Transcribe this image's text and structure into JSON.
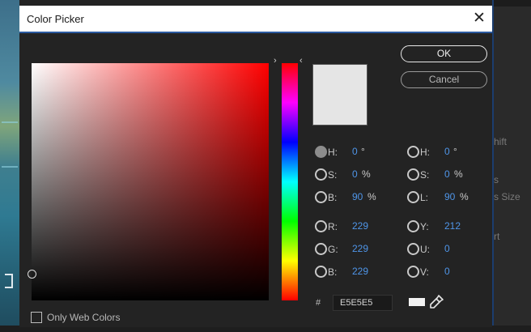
{
  "dialog": {
    "title": "Color Picker",
    "close_glyph": "✕",
    "ok_label": "OK",
    "cancel_label": "Cancel"
  },
  "current_color": "#E5E5E5",
  "hex": {
    "hash": "#",
    "value": "E5E5E5"
  },
  "hsb": {
    "h": {
      "label": "H:",
      "value": "0",
      "unit": "°",
      "selected": true
    },
    "s": {
      "label": "S:",
      "value": "0",
      "unit": "%"
    },
    "b": {
      "label": "B:",
      "value": "90",
      "unit": "%"
    }
  },
  "hsl": {
    "h": {
      "label": "H:",
      "value": "0",
      "unit": "°"
    },
    "s": {
      "label": "S:",
      "value": "0",
      "unit": "%"
    },
    "l": {
      "label": "L:",
      "value": "90",
      "unit": "%"
    }
  },
  "rgb": {
    "r": {
      "label": "R:",
      "value": "229"
    },
    "g": {
      "label": "G:",
      "value": "229"
    },
    "b": {
      "label": "B:",
      "value": "229"
    }
  },
  "yuv": {
    "y": {
      "label": "Y:",
      "value": "212"
    },
    "u": {
      "label": "U:",
      "value": "0"
    },
    "v": {
      "label": "V:",
      "value": "0"
    }
  },
  "only_web_colors_label": "Only Web Colors",
  "background_panel": {
    "items": [
      "hift",
      "s",
      "s Size",
      "rt"
    ]
  },
  "colors": {
    "value_text": "#4f95e8",
    "dialog_bg": "#232323",
    "title_bar": "#ffffff"
  }
}
